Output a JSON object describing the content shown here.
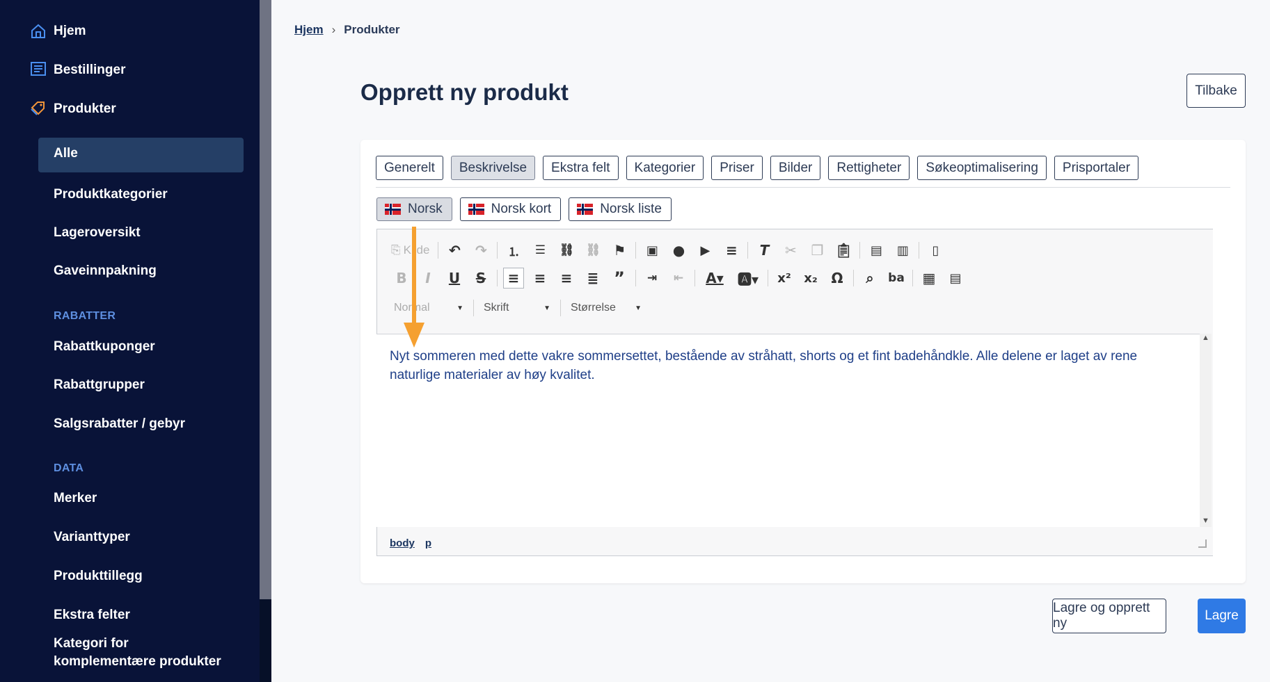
{
  "sidebar": {
    "main_items": [
      {
        "label": "Hjem",
        "icon": "home-icon"
      },
      {
        "label": "Bestillinger",
        "icon": "orders-icon"
      },
      {
        "label": "Produkter",
        "icon": "tag-icon"
      }
    ],
    "product_items": [
      "Alle",
      "Produktkategorier",
      "Lageroversikt",
      "Gaveinnpakning"
    ],
    "section_rabatter": "RABATTER",
    "rabatter_items": [
      "Rabattkuponger",
      "Rabattgrupper",
      "Salgsrabatter / gebyr"
    ],
    "section_data": "DATA",
    "data_items": [
      "Merker",
      "Varianttyper",
      "Produkttillegg",
      "Ekstra felter",
      "Kategori for",
      "komplementære produkter"
    ]
  },
  "breadcrumb": {
    "home": "Hjem",
    "separator": "›",
    "current": "Produkter"
  },
  "page": {
    "title": "Opprett ny produkt",
    "back_label": "Tilbake"
  },
  "tabs": [
    "Generelt",
    "Beskrivelse",
    "Ekstra felt",
    "Kategorier",
    "Priser",
    "Bilder",
    "Rettigheter",
    "Søkeoptimalisering",
    "Prisportaler"
  ],
  "active_tab": "Beskrivelse",
  "lang_tabs": [
    "Norsk",
    "Norsk kort",
    "Norsk liste"
  ],
  "editor": {
    "source_label": "Kilde",
    "format_combo": "Normal",
    "font_combo": "Skrift",
    "size_combo": "Størrelse",
    "content": "Nyt sommeren med dette vakre sommersettet, bestående av stråhatt, shorts og et fint badehåndkle. Alle delene er laget av rene naturlige materialer av høy kvalitet.",
    "path": [
      "body",
      "p"
    ]
  },
  "actions": {
    "save_new": "Lagre og opprett ny",
    "save": "Lagre"
  },
  "colors": {
    "sidebar": "#091338",
    "active": "#253f66",
    "primary": "#2f7ae5",
    "arrow": "#f5a030"
  }
}
